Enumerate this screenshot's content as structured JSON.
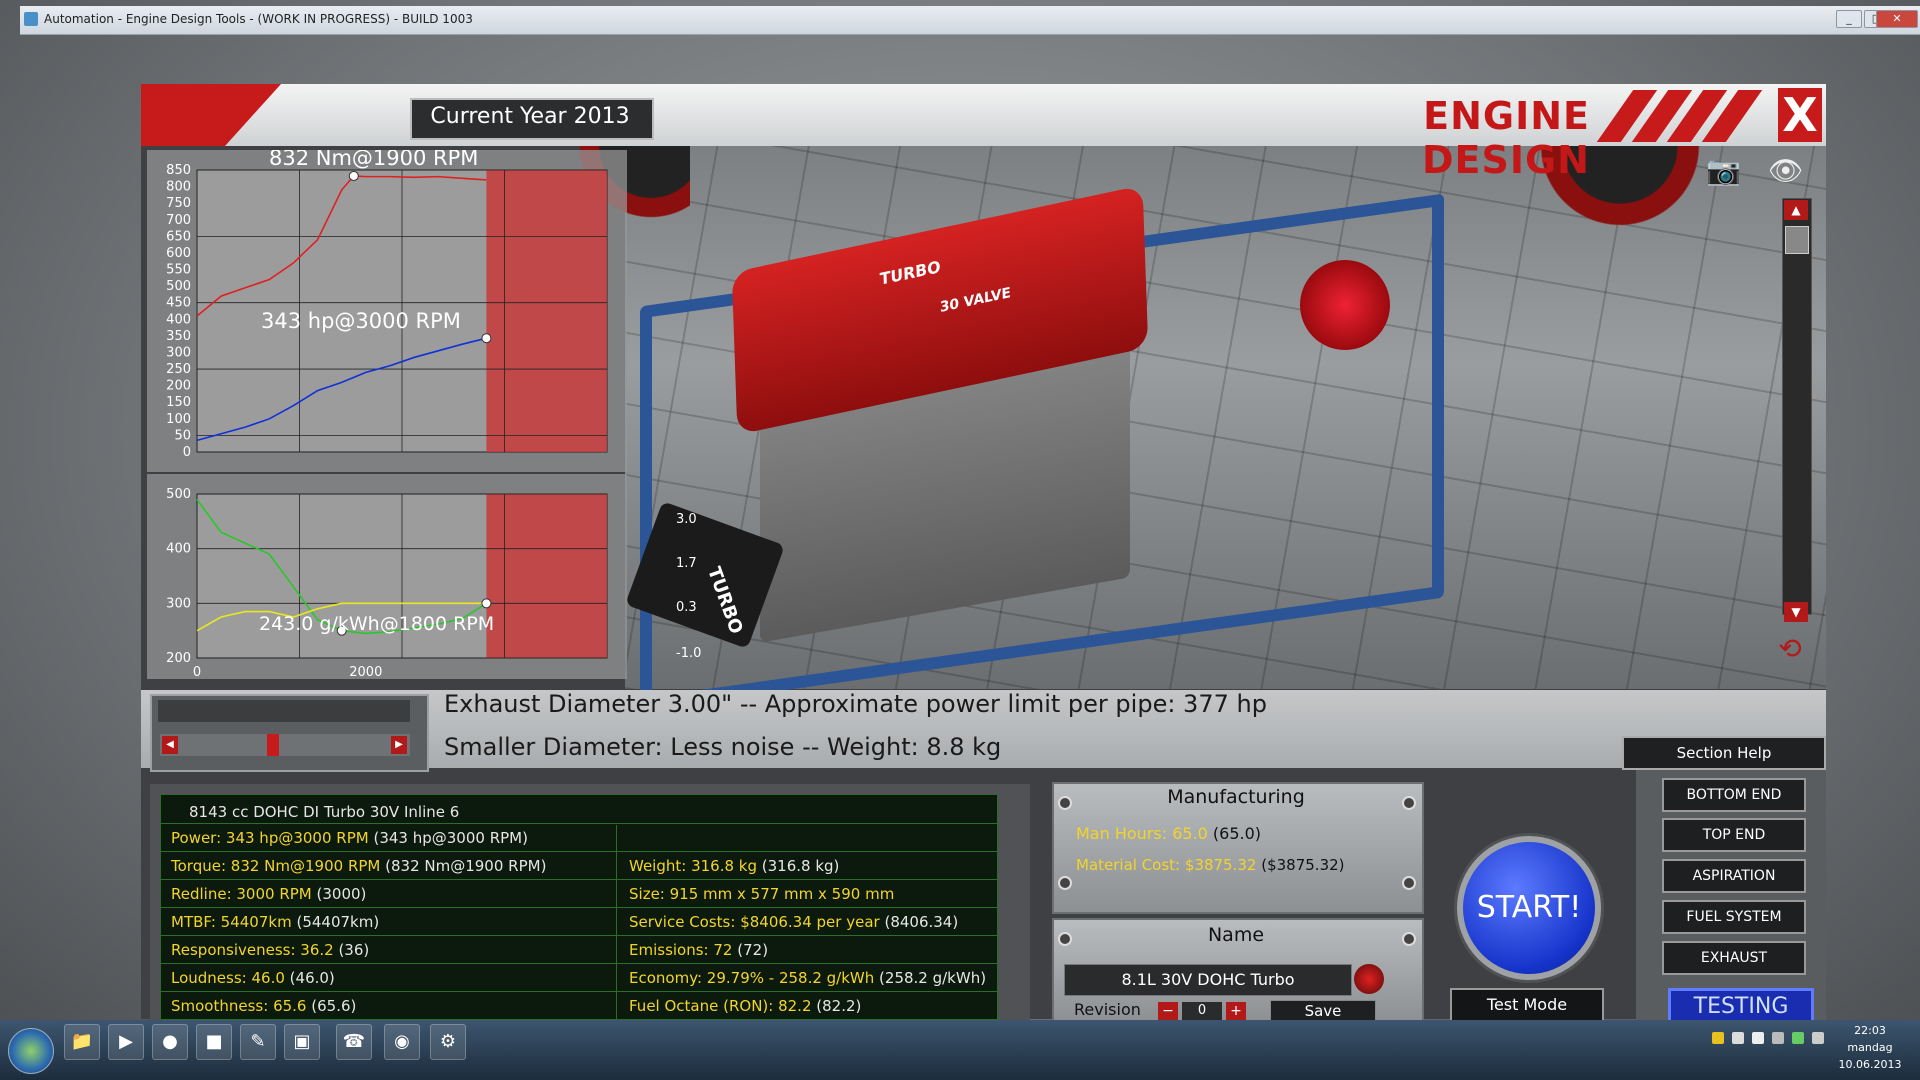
{
  "window": {
    "title": "Automation - Engine Design Tools - (WORK IN PROGRESS) - BUILD 1003",
    "minimize": "_",
    "maximize": "□",
    "close": "✕"
  },
  "header": {
    "year_label": "Current Year 2013",
    "title": "ENGINE DESIGN",
    "close_label": "X"
  },
  "scene": {
    "cover_text_turbo": "TURBO",
    "cover_text_valve": "30 VALVE",
    "turbo_box_label": "TURBO",
    "gauge_values": [
      "3.0",
      "1.7",
      "0.3",
      "-1.0"
    ]
  },
  "chart_data": [
    {
      "type": "line",
      "title": "",
      "x": [
        600,
        800,
        1000,
        1200,
        1400,
        1600,
        1800,
        1900,
        2000,
        2200,
        2400,
        2600,
        2800,
        3000
      ],
      "series": [
        {
          "color": "#e02020",
          "values": [
            410,
            470,
            495,
            520,
            570,
            640,
            790,
            832,
            830,
            830,
            828,
            830,
            825,
            820
          ]
        },
        {
          "color": "#1030d8",
          "values": [
            35,
            55,
            75,
            100,
            140,
            185,
            210,
            225,
            240,
            260,
            285,
            305,
            325,
            343
          ]
        }
      ],
      "annotations": [
        "832 Nm@1900 RPM",
        "343 hp@3000 RPM"
      ],
      "yticks": [
        "850",
        "800",
        "750",
        "700",
        "650",
        "600",
        "550",
        "500",
        "450",
        "400",
        "350",
        "300",
        "250",
        "200",
        "150",
        "100",
        "50",
        "0"
      ],
      "ylim": [
        0,
        850
      ],
      "xlim": [
        600,
        4000
      ],
      "redline_rpm": 3000,
      "grid": true
    },
    {
      "type": "line",
      "title": "",
      "x": [
        600,
        800,
        1000,
        1200,
        1400,
        1600,
        1800,
        2000,
        2200,
        2400,
        2600,
        2800,
        3000
      ],
      "series": [
        {
          "color": "#28c828",
          "values": [
            490,
            430,
            410,
            390,
            330,
            270,
            250,
            245,
            248,
            255,
            262,
            272,
            300
          ]
        },
        {
          "color": "#e8e820",
          "values": [
            250,
            275,
            285,
            285,
            275,
            290,
            300,
            300,
            300,
            300,
            300,
            300,
            300
          ]
        }
      ],
      "annotations": [
        "243.0 g/kWh@1800 RPM"
      ],
      "yticks": [
        "500",
        "400",
        "300",
        "200"
      ],
      "xticks": [
        "0",
        "2000"
      ],
      "ylim": [
        200,
        500
      ],
      "xlim": [
        600,
        4000
      ],
      "redline_rpm": 3000,
      "grid": true
    }
  ],
  "description": {
    "line1": "Exhaust Diameter 3.00\" -- Approximate power limit per pipe: 377 hp",
    "line2": "Smaller Diameter: Less noise -- Weight: 8.8 kg",
    "slider_value": 0.45,
    "left_arrow": "◀",
    "right_arrow": "▶"
  },
  "section_help": "Section Help",
  "stats": {
    "engine_name": "8143 cc DOHC DI Turbo 30V Inline 6",
    "left": [
      {
        "label": "Power: 343 hp@3000 RPM",
        "value": "(343 hp@3000 RPM)"
      },
      {
        "label": "Torque: 832 Nm@1900 RPM",
        "value": "(832 Nm@1900 RPM)"
      },
      {
        "label": "Redline: 3000 RPM",
        "value": "(3000)"
      },
      {
        "label": "MTBF: 54407km",
        "value": "(54407km)"
      },
      {
        "label": "Responsiveness: 36.2",
        "value": "(36)"
      },
      {
        "label": "Loudness: 46.0",
        "value": "(46.0)"
      },
      {
        "label": "Smoothness: 65.6",
        "value": "(65.6)"
      }
    ],
    "right": [
      {
        "label": "Weight: 316.8 kg",
        "value": "(316.8 kg)"
      },
      {
        "label": "Size: 915 mm x 577 mm x 590 mm",
        "value": ""
      },
      {
        "label": "Service Costs: $8406.34 per year",
        "value": "(8406.34)"
      },
      {
        "label": "Emissions: 72",
        "value": "(72)"
      },
      {
        "label": "Economy: 29.79% - 258.2 g/kWh",
        "value": "(258.2 g/kWh)"
      },
      {
        "label": "Fuel Octane (RON): 82.2",
        "value": "(82.2)"
      }
    ]
  },
  "manufacturing": {
    "title": "Manufacturing",
    "man_hours_label": "Man Hours: 65.0",
    "man_hours_value": "(65.0)",
    "material_cost_label": "Material Cost: $3875.32",
    "material_cost_value": "($3875.32)"
  },
  "name_panel": {
    "title": "Name",
    "name_value": "8.1L 30V DOHC Turbo",
    "revision_label": "Revision",
    "revision_value": "0",
    "minus": "−",
    "plus": "+",
    "save_label": "Save"
  },
  "start_label": "START!",
  "test_mode_label": "Test Mode",
  "section_menu": [
    "BOTTOM END",
    "TOP END",
    "ASPIRATION",
    "FUEL SYSTEM",
    "EXHAUST"
  ],
  "testing_label": "TESTING",
  "taskbar": {
    "clock_time": "22:03",
    "clock_day": "mandag",
    "clock_date": "10.06.2013"
  },
  "colors": {
    "accent_red": "#c71a1a",
    "stats_yellow": "#f2d42a",
    "start_blue": "#1533c9"
  }
}
